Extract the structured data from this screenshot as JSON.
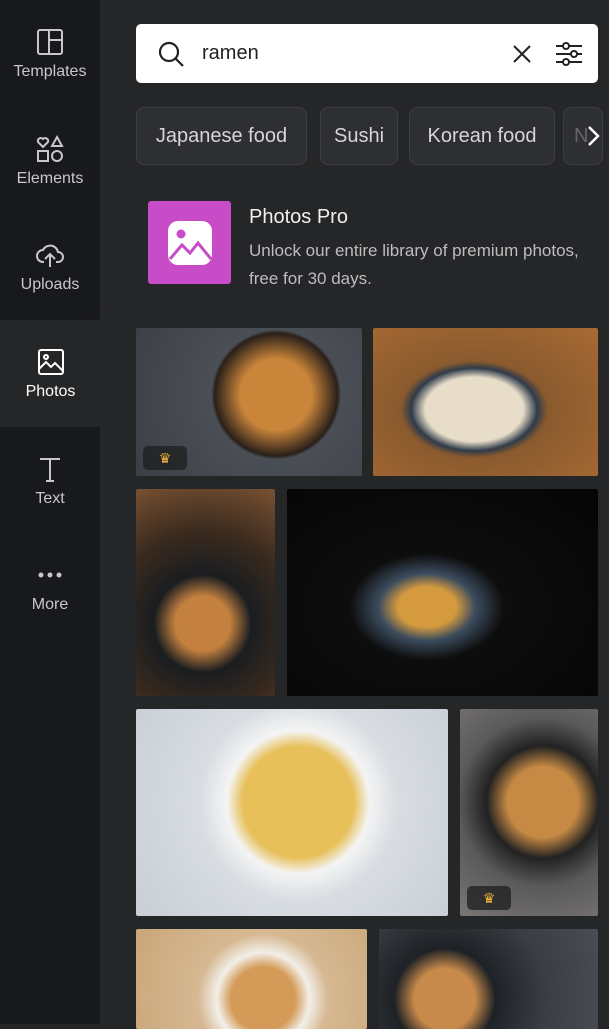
{
  "sidebar": {
    "items": [
      {
        "label": "Templates",
        "icon": "templates-icon"
      },
      {
        "label": "Elements",
        "icon": "elements-icon"
      },
      {
        "label": "Uploads",
        "icon": "upload-cloud-icon"
      },
      {
        "label": "Photos",
        "icon": "photo-icon",
        "active": true
      },
      {
        "label": "Text",
        "icon": "text-icon"
      },
      {
        "label": "More",
        "icon": "more-dots-icon"
      }
    ]
  },
  "search": {
    "value": "ramen"
  },
  "chips": [
    "Japanese food",
    "Sushi",
    "Korean food",
    "N"
  ],
  "promo": {
    "title": "Photos Pro",
    "description": "Unlock our entire library of premium photos, free for 30 days.",
    "color": "#c84bc8"
  },
  "photos": [
    {
      "alt": "ramen bowl with egg and chopsticks",
      "pro": true
    },
    {
      "alt": "ramen with pork and spoon",
      "pro": false
    },
    {
      "alt": "noodles lifted from bowl",
      "pro": false
    },
    {
      "alt": "noodles with chopsticks on dark background",
      "pro": false
    },
    {
      "alt": "yellow noodles with red chopsticks",
      "pro": false
    },
    {
      "alt": "ramen with eggs and mushrooms",
      "pro": true
    },
    {
      "alt": "ramen bowl on wood",
      "pro": false
    },
    {
      "alt": "ramen on dark stone",
      "pro": false
    }
  ]
}
